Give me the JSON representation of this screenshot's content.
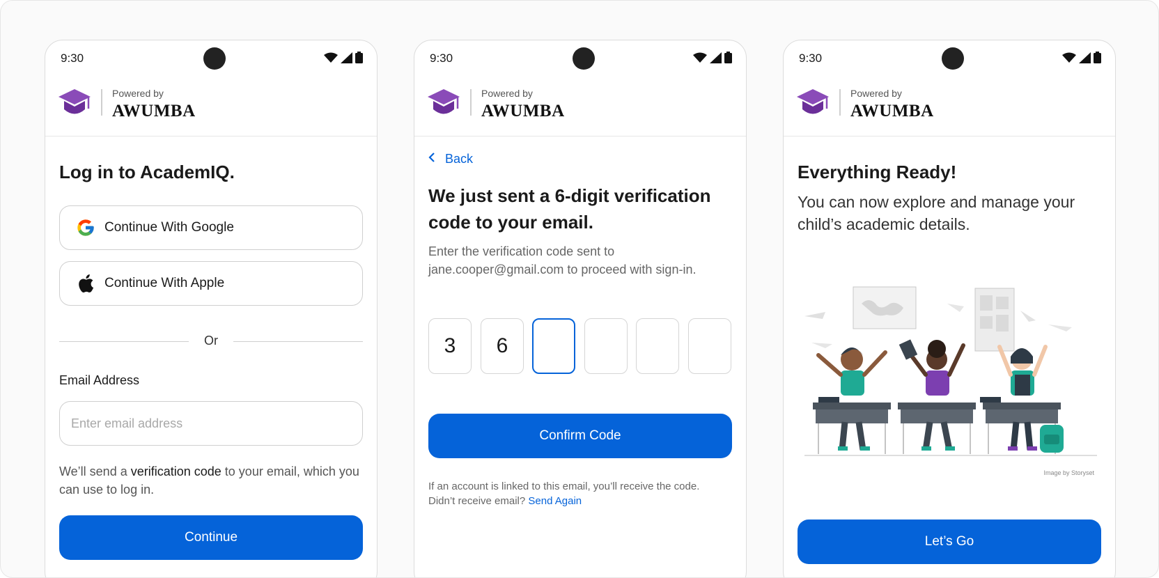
{
  "status_bar": {
    "time": "9:30"
  },
  "brand": {
    "powered_by": "Powered by",
    "name": "AWUMBA"
  },
  "login": {
    "title": "Log in to AcademIQ.",
    "google_label": "Continue With Google",
    "apple_label": "Continue With Apple",
    "or_label": "Or",
    "email_label": "Email Address",
    "email_placeholder": "Enter email address",
    "email_value": "",
    "helper_pre": "We’ll send a ",
    "helper_bold": "verification code",
    "helper_post": " to your email, which you can use to log in.",
    "continue_label": "Continue"
  },
  "verify": {
    "back_label": "Back",
    "title": "We just sent a 6-digit verification code to your email.",
    "subtitle": "Enter the verification code sent to jane.cooper@gmail.com to proceed with sign-in.",
    "code_digits": [
      "3",
      "6",
      "",
      "",
      "",
      ""
    ],
    "confirm_label": "Confirm Code",
    "footnote": "If an account is linked to this email, you’ll receive the code. Didn’t receive email?",
    "send_again_label": "Send Again"
  },
  "ready": {
    "title": "Everything Ready!",
    "subtitle": "You can now explore and manage your child’s academic details.",
    "image_credit": "Image by Storyset",
    "go_label": "Let’s Go"
  },
  "colors": {
    "primary": "#0563d9",
    "brand_purple": "#7a3ea6"
  },
  "icons": [
    "graduation-cap-icon",
    "google-icon",
    "apple-icon",
    "chevron-left-icon",
    "wifi-icon",
    "signal-icon",
    "battery-icon"
  ]
}
